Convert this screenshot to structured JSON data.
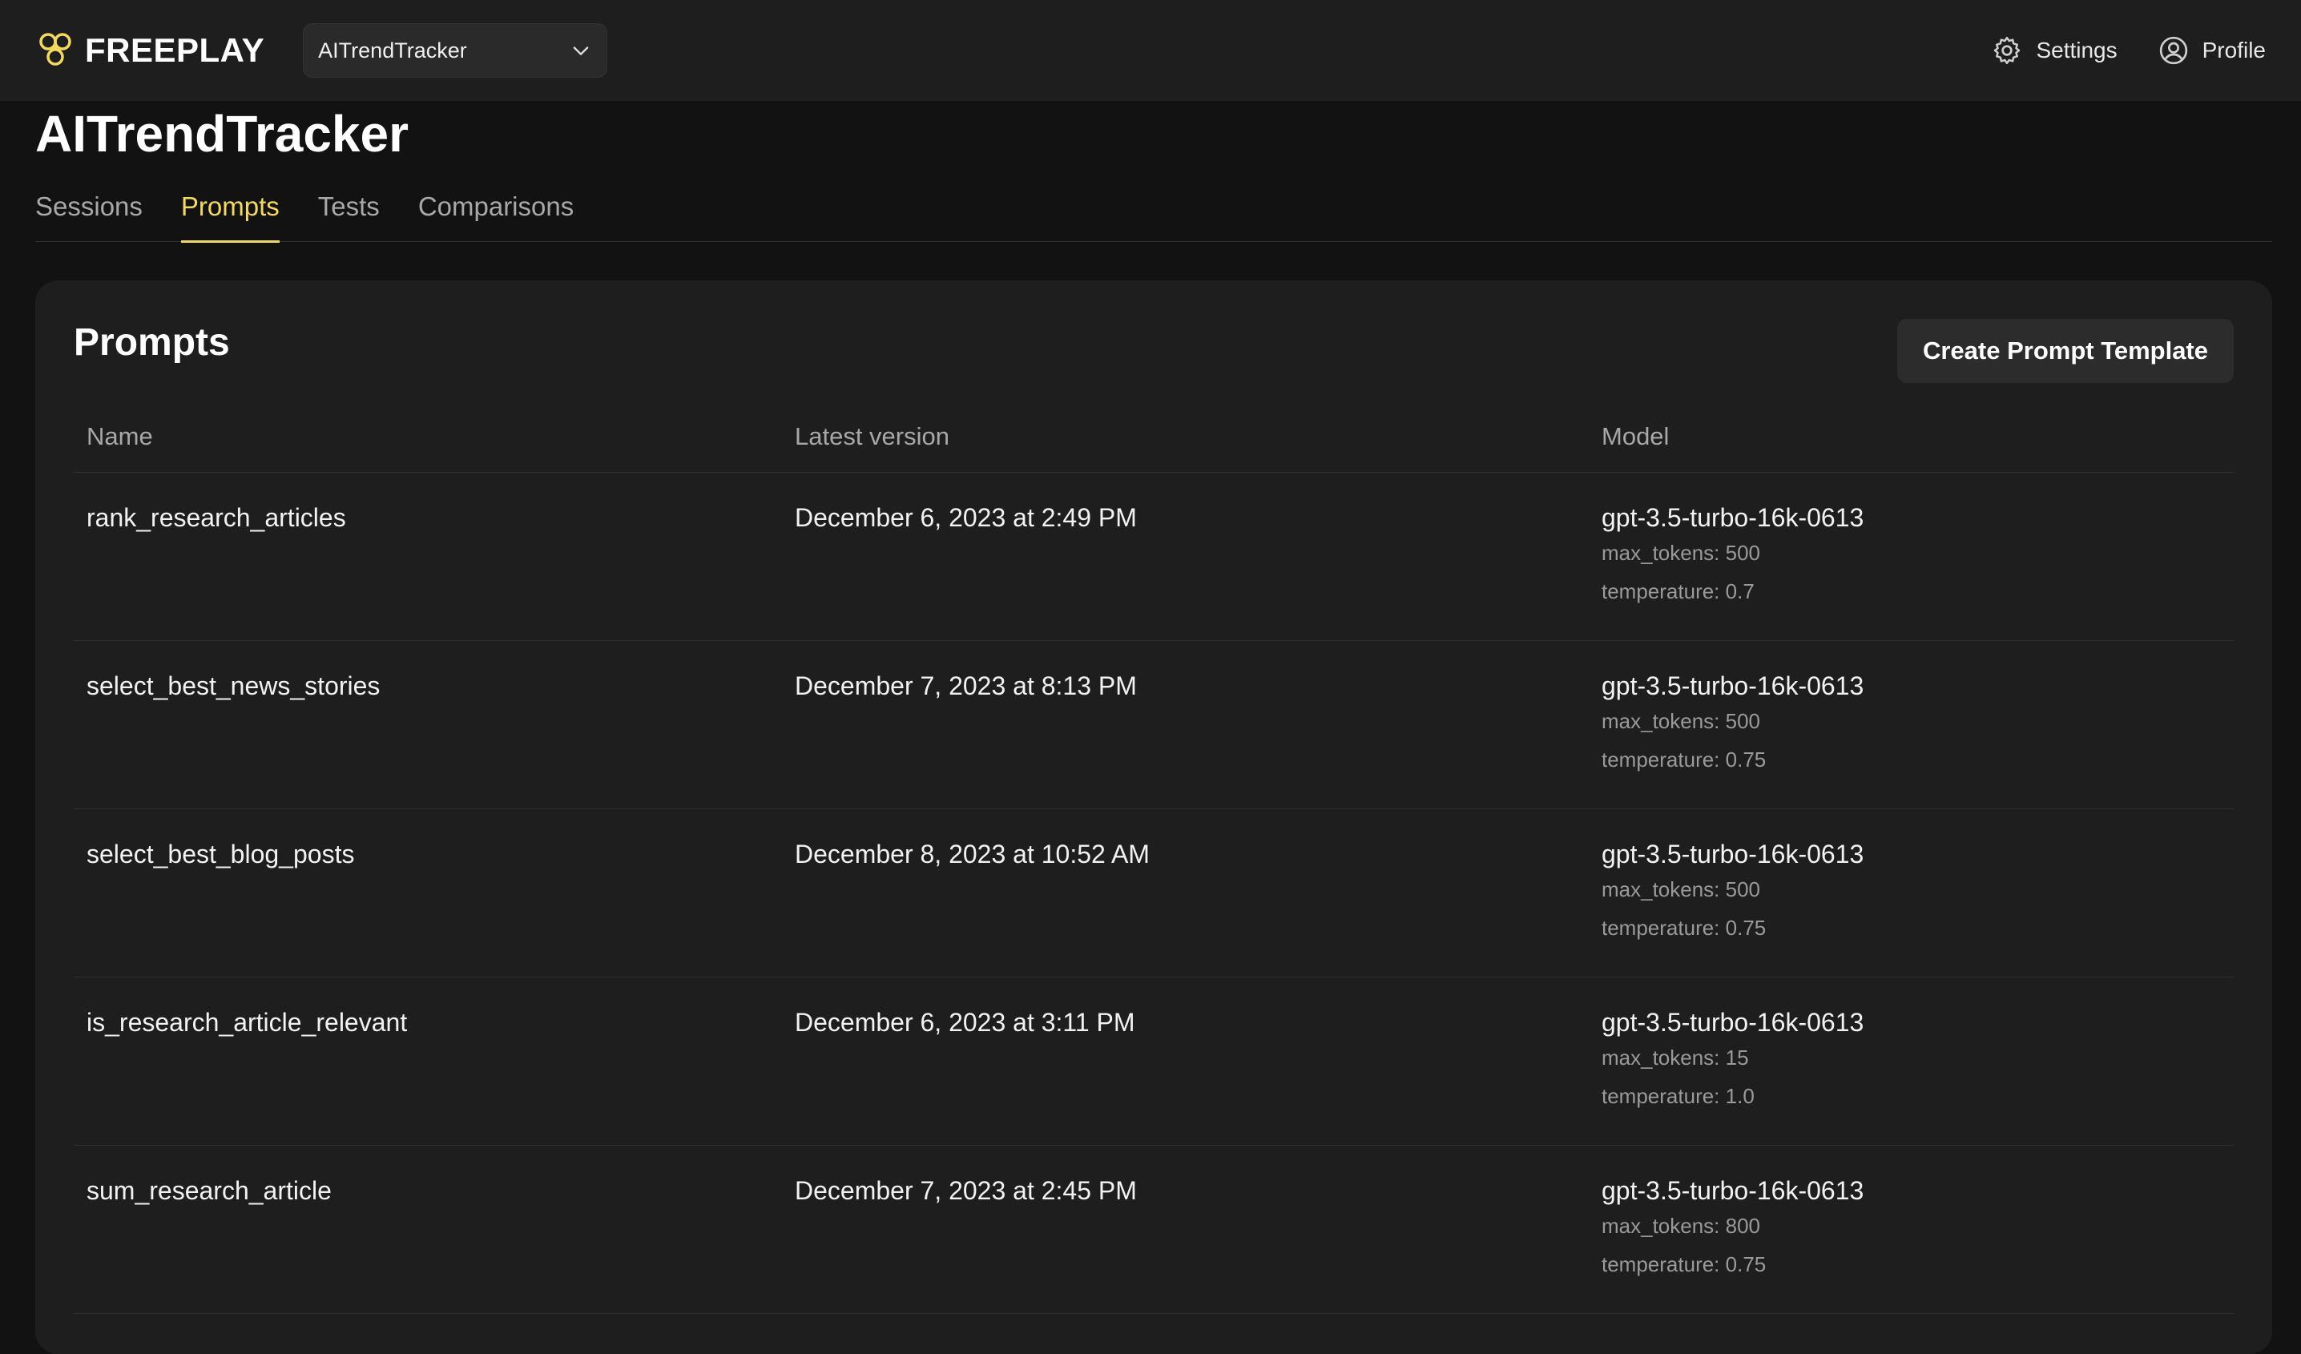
{
  "app": {
    "brand": "FREEPLAY",
    "project_selector": "AITrendTracker",
    "settings_label": "Settings",
    "profile_label": "Profile"
  },
  "page": {
    "title": "AITrendTracker",
    "tabs": [
      {
        "label": "Sessions",
        "active": false
      },
      {
        "label": "Prompts",
        "active": true
      },
      {
        "label": "Tests",
        "active": false
      },
      {
        "label": "Comparisons",
        "active": false
      }
    ]
  },
  "prompts": {
    "heading": "Prompts",
    "create_button": "Create Prompt Template",
    "columns": [
      "Name",
      "Latest version",
      "Model"
    ],
    "rows": [
      {
        "name": "rank_research_articles",
        "version": "December 6, 2023 at 2:49 PM",
        "model": "gpt-3.5-turbo-16k-0613",
        "max_tokens": "max_tokens: 500",
        "temperature": "temperature: 0.7"
      },
      {
        "name": "select_best_news_stories",
        "version": "December 7, 2023 at 8:13 PM",
        "model": "gpt-3.5-turbo-16k-0613",
        "max_tokens": "max_tokens: 500",
        "temperature": "temperature: 0.75"
      },
      {
        "name": "select_best_blog_posts",
        "version": "December 8, 2023 at 10:52 AM",
        "model": "gpt-3.5-turbo-16k-0613",
        "max_tokens": "max_tokens: 500",
        "temperature": "temperature: 0.75"
      },
      {
        "name": "is_research_article_relevant",
        "version": "December 6, 2023 at 3:11 PM",
        "model": "gpt-3.5-turbo-16k-0613",
        "max_tokens": "max_tokens: 15",
        "temperature": "temperature: 1.0"
      },
      {
        "name": "sum_research_article",
        "version": "December 7, 2023 at 2:45 PM",
        "model": "gpt-3.5-turbo-16k-0613",
        "max_tokens": "max_tokens: 800",
        "temperature": "temperature: 0.75"
      }
    ]
  },
  "colors": {
    "accent": "#f3d95c",
    "background": "#121212",
    "surface": "#1e1e1e"
  },
  "icons": [
    "freeplay-logo-icon",
    "chevron-down-icon",
    "gear-icon",
    "user-circle-icon"
  ]
}
